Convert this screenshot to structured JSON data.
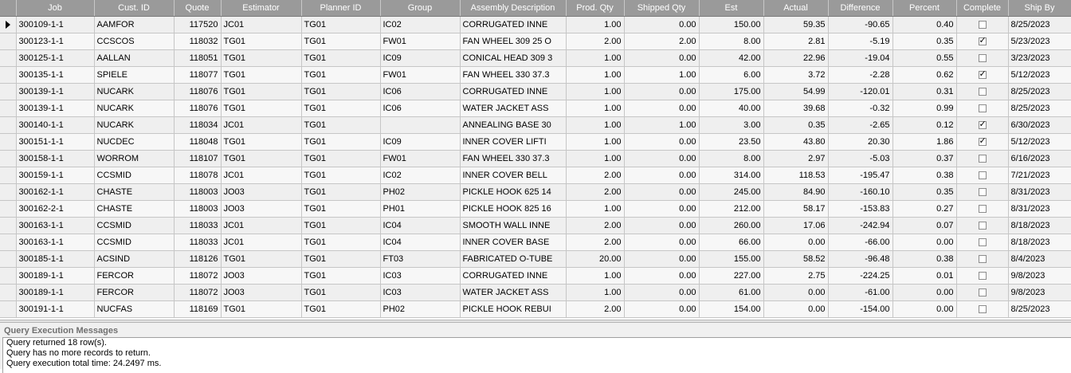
{
  "grid": {
    "columns": [
      "Job",
      "Cust. ID",
      "Quote",
      "Estimator",
      "Planner ID",
      "Group",
      "Assembly Description",
      "Prod. Qty",
      "Shipped Qty",
      "Est",
      "Actual",
      "Difference",
      "Percent",
      "Complete",
      "Ship By"
    ],
    "rows": [
      {
        "job": "300109-1-1",
        "cust": "AAMFOR",
        "quote": "117520",
        "estimator": "JC01",
        "planner": "TG01",
        "group": "IC02",
        "desc": "CORRUGATED INNE",
        "prod": "1.00",
        "shipped": "0.00",
        "est": "150.00",
        "actual": "59.35",
        "diff": "-90.65",
        "pct": "0.40",
        "complete": false,
        "shipby": "8/25/2023"
      },
      {
        "job": "300123-1-1",
        "cust": "CCSCOS",
        "quote": "118032",
        "estimator": "TG01",
        "planner": "TG01",
        "group": "FW01",
        "desc": "FAN WHEEL 309 25 O",
        "prod": "2.00",
        "shipped": "2.00",
        "est": "8.00",
        "actual": "2.81",
        "diff": "-5.19",
        "pct": "0.35",
        "complete": true,
        "shipby": "5/23/2023"
      },
      {
        "job": "300125-1-1",
        "cust": "AALLAN",
        "quote": "118051",
        "estimator": "TG01",
        "planner": "TG01",
        "group": "IC09",
        "desc": "CONICAL HEAD 309 3",
        "prod": "1.00",
        "shipped": "0.00",
        "est": "42.00",
        "actual": "22.96",
        "diff": "-19.04",
        "pct": "0.55",
        "complete": false,
        "shipby": "3/23/2023"
      },
      {
        "job": "300135-1-1",
        "cust": "SPIELE",
        "quote": "118077",
        "estimator": "TG01",
        "planner": "TG01",
        "group": "FW01",
        "desc": "FAN WHEEL 330 37.3",
        "prod": "1.00",
        "shipped": "1.00",
        "est": "6.00",
        "actual": "3.72",
        "diff": "-2.28",
        "pct": "0.62",
        "complete": true,
        "shipby": "5/12/2023"
      },
      {
        "job": "300139-1-1",
        "cust": "NUCARK",
        "quote": "118076",
        "estimator": "TG01",
        "planner": "TG01",
        "group": "IC06",
        "desc": "CORRUGATED INNE",
        "prod": "1.00",
        "shipped": "0.00",
        "est": "175.00",
        "actual": "54.99",
        "diff": "-120.01",
        "pct": "0.31",
        "complete": false,
        "shipby": "8/25/2023"
      },
      {
        "job": "300139-1-1",
        "cust": "NUCARK",
        "quote": "118076",
        "estimator": "TG01",
        "planner": "TG01",
        "group": "IC06",
        "desc": "WATER JACKET ASS",
        "prod": "1.00",
        "shipped": "0.00",
        "est": "40.00",
        "actual": "39.68",
        "diff": "-0.32",
        "pct": "0.99",
        "complete": false,
        "shipby": "8/25/2023"
      },
      {
        "job": "300140-1-1",
        "cust": "NUCARK",
        "quote": "118034",
        "estimator": "JC01",
        "planner": "TG01",
        "group": "",
        "desc": "ANNEALING BASE 30",
        "prod": "1.00",
        "shipped": "1.00",
        "est": "3.00",
        "actual": "0.35",
        "diff": "-2.65",
        "pct": "0.12",
        "complete": true,
        "shipby": "6/30/2023"
      },
      {
        "job": "300151-1-1",
        "cust": "NUCDEC",
        "quote": "118048",
        "estimator": "TG01",
        "planner": "TG01",
        "group": "IC09",
        "desc": "INNER COVER LIFTI",
        "prod": "1.00",
        "shipped": "0.00",
        "est": "23.50",
        "actual": "43.80",
        "diff": "20.30",
        "pct": "1.86",
        "complete": true,
        "shipby": "5/12/2023"
      },
      {
        "job": "300158-1-1",
        "cust": "WORROM",
        "quote": "118107",
        "estimator": "TG01",
        "planner": "TG01",
        "group": "FW01",
        "desc": "FAN WHEEL 330 37.3",
        "prod": "1.00",
        "shipped": "0.00",
        "est": "8.00",
        "actual": "2.97",
        "diff": "-5.03",
        "pct": "0.37",
        "complete": false,
        "shipby": "6/16/2023"
      },
      {
        "job": "300159-1-1",
        "cust": "CCSMID",
        "quote": "118078",
        "estimator": "JC01",
        "planner": "TG01",
        "group": "IC02",
        "desc": "INNER COVER BELL",
        "prod": "2.00",
        "shipped": "0.00",
        "est": "314.00",
        "actual": "118.53",
        "diff": "-195.47",
        "pct": "0.38",
        "complete": false,
        "shipby": "7/21/2023"
      },
      {
        "job": "300162-1-1",
        "cust": "CHASTE",
        "quote": "118003",
        "estimator": "JO03",
        "planner": "TG01",
        "group": "PH02",
        "desc": "PICKLE HOOK 625 14",
        "prod": "2.00",
        "shipped": "0.00",
        "est": "245.00",
        "actual": "84.90",
        "diff": "-160.10",
        "pct": "0.35",
        "complete": false,
        "shipby": "8/31/2023"
      },
      {
        "job": "300162-2-1",
        "cust": "CHASTE",
        "quote": "118003",
        "estimator": "JO03",
        "planner": "TG01",
        "group": "PH01",
        "desc": "PICKLE HOOK 825 16",
        "prod": "1.00",
        "shipped": "0.00",
        "est": "212.00",
        "actual": "58.17",
        "diff": "-153.83",
        "pct": "0.27",
        "complete": false,
        "shipby": "8/31/2023"
      },
      {
        "job": "300163-1-1",
        "cust": "CCSMID",
        "quote": "118033",
        "estimator": "JC01",
        "planner": "TG01",
        "group": "IC04",
        "desc": "SMOOTH WALL INNE",
        "prod": "2.00",
        "shipped": "0.00",
        "est": "260.00",
        "actual": "17.06",
        "diff": "-242.94",
        "pct": "0.07",
        "complete": false,
        "shipby": "8/18/2023"
      },
      {
        "job": "300163-1-1",
        "cust": "CCSMID",
        "quote": "118033",
        "estimator": "JC01",
        "planner": "TG01",
        "group": "IC04",
        "desc": "INNER COVER BASE",
        "prod": "2.00",
        "shipped": "0.00",
        "est": "66.00",
        "actual": "0.00",
        "diff": "-66.00",
        "pct": "0.00",
        "complete": false,
        "shipby": "8/18/2023"
      },
      {
        "job": "300185-1-1",
        "cust": "ACSIND",
        "quote": "118126",
        "estimator": "TG01",
        "planner": "TG01",
        "group": "FT03",
        "desc": "FABRICATED O-TUBE",
        "prod": "20.00",
        "shipped": "0.00",
        "est": "155.00",
        "actual": "58.52",
        "diff": "-96.48",
        "pct": "0.38",
        "complete": false,
        "shipby": "8/4/2023"
      },
      {
        "job": "300189-1-1",
        "cust": "FERCOR",
        "quote": "118072",
        "estimator": "JO03",
        "planner": "TG01",
        "group": "IC03",
        "desc": "CORRUGATED INNE",
        "prod": "1.00",
        "shipped": "0.00",
        "est": "227.00",
        "actual": "2.75",
        "diff": "-224.25",
        "pct": "0.01",
        "complete": false,
        "shipby": "9/8/2023"
      },
      {
        "job": "300189-1-1",
        "cust": "FERCOR",
        "quote": "118072",
        "estimator": "JO03",
        "planner": "TG01",
        "group": "IC03",
        "desc": "WATER JACKET ASS",
        "prod": "1.00",
        "shipped": "0.00",
        "est": "61.00",
        "actual": "0.00",
        "diff": "-61.00",
        "pct": "0.00",
        "complete": false,
        "shipby": "9/8/2023"
      },
      {
        "job": "300191-1-1",
        "cust": "NUCFAS",
        "quote": "118169",
        "estimator": "TG01",
        "planner": "TG01",
        "group": "PH02",
        "desc": "PICKLE HOOK REBUI",
        "prod": "2.00",
        "shipped": "0.00",
        "est": "154.00",
        "actual": "0.00",
        "diff": "-154.00",
        "pct": "0.00",
        "complete": false,
        "shipby": "8/25/2023"
      }
    ],
    "current_row_index": 0
  },
  "messages": {
    "title": "Query Execution Messages",
    "lines": [
      "Query returned 18 row(s).",
      "Query has no more records to return.",
      "Query execution total time: 24.2497 ms."
    ]
  },
  "colors": {
    "header_bg": "#9a9a9a",
    "header_text": "#ffffff",
    "row_bg": "#efefef",
    "grid_line": "#c6c6c6"
  }
}
